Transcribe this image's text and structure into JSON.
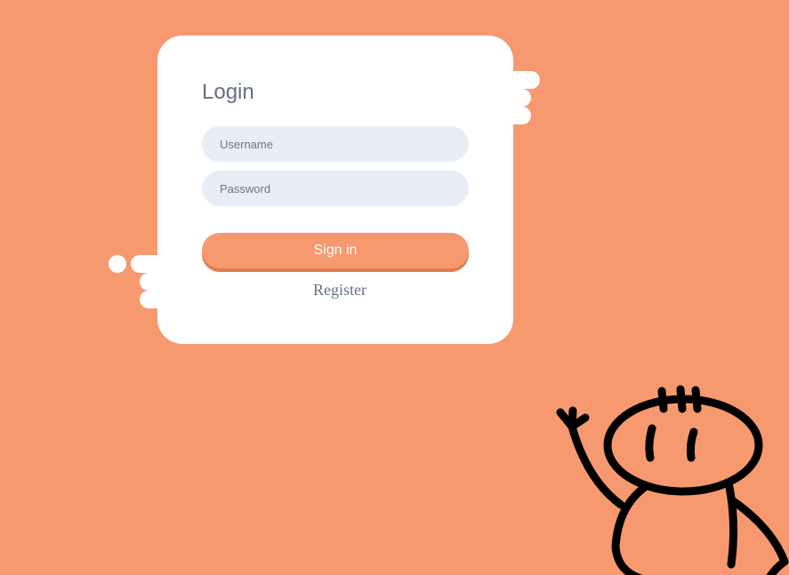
{
  "login": {
    "title": "Login",
    "username_placeholder": "Username",
    "username_value": "",
    "password_placeholder": "Password",
    "password_value": "",
    "signin_label": "Sign in",
    "register_label": "Register"
  },
  "colors": {
    "background": "#f6996f",
    "card": "#ffffff",
    "input_bg": "#e8eef6",
    "button": "#f6996f",
    "button_shadow": "#de7d52",
    "text": "#65707f"
  },
  "icons": {
    "character": "waving-doodle-character"
  }
}
